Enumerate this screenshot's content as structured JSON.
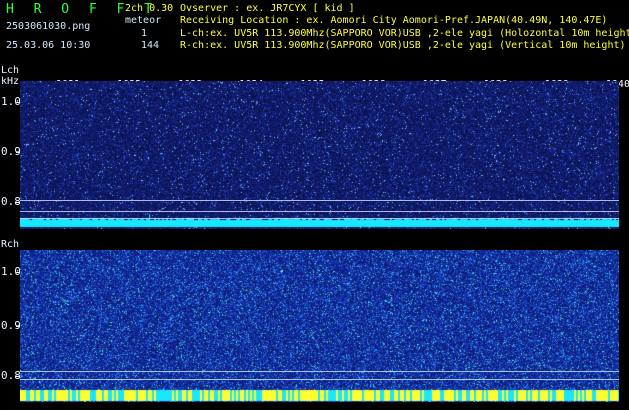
{
  "header": {
    "app_title": "H R O F F T",
    "version": "2ch 0.30",
    "filename": "2503061030.png",
    "datetime": "25.03.06 10:30",
    "meteor_label": "meteor",
    "lch_count": "1",
    "rch_count": "144",
    "observer_line": "Ovserver           : ex. JR7CYX [ kid ]",
    "location_line": "Receiving Location : ex. Aomori City Aomori-Pref.JAPAN(40.49N, 140.47E)",
    "lch_line": "L-ch:ex. UV5R 113.900Mhz(SAPPORO VOR)USB ,2-ele yagi (Holozontal 10m height)",
    "rch_line": "R-ch:ex. UV5R 113.900Mhz(SAPPORO VOR)USB ,2-ele yagi (Vertical 10m height)"
  },
  "lch_panel": {
    "channel_label": "Lch",
    "unit_label": "kHz",
    "y_ticks": [
      "1.0",
      "0.9",
      "0.8"
    ],
    "x_ticks": [
      "1031",
      "1032",
      "1033",
      "1034",
      "1035",
      "1036",
      "1037",
      "1038",
      "1039",
      "1040"
    ]
  },
  "rch_panel": {
    "channel_label": "Rch",
    "y_ticks": [
      "1.0",
      "0.9",
      "0.8"
    ]
  },
  "colors": {
    "background": "#000000",
    "lch_noise": "#1a2a8a",
    "rch_noise": "#1a3aa8",
    "baseline_cyan": "#19e6ff",
    "baseline_yellow": "#ffff30",
    "title_green": "#33ff33",
    "label_yellow": "#ffff3a"
  }
}
